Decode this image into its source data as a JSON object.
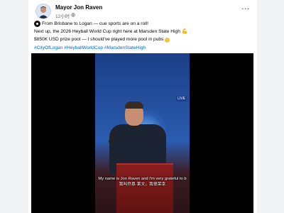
{
  "post": {
    "author": "Mayor Jon Raven",
    "timestamp": "12小时",
    "privacy_icon": "globe-icon",
    "more_label": "···",
    "text_line1": "From Brisbane to Logan — cue sports are on a roll!",
    "text_line2": "Next up, the 2026 Heyball World Cup right here at Marsden State High",
    "text_line3": "$850K USD prize pool — I should've played more pool in pubs",
    "hashtags": "#CityOfLogan #HeyballWorldCup #MarsdenStateHigh"
  },
  "video": {
    "badge": "LIVE",
    "caption_en": "My name is Jon Raven and I'm very grateful to b",
    "caption_zh": "我叫乔恩·莱文，我很荣幸"
  },
  "colors": {
    "link": "#0064d1",
    "text": "#050505",
    "secondary": "#65676b"
  }
}
